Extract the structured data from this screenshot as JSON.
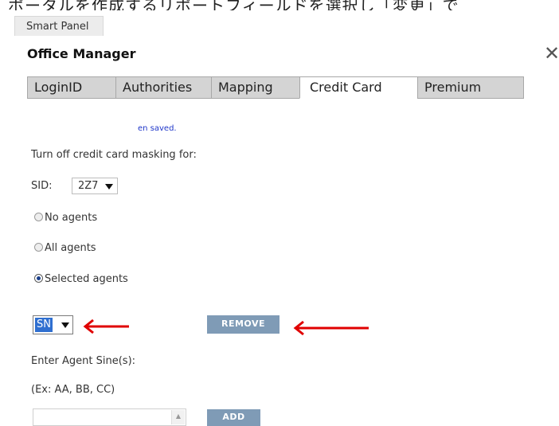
{
  "top_text": "ポータルを作成するリポートフィールドを選択し「変更」で",
  "window": {
    "panel_tab": "Smart Panel",
    "title": "Office Manager",
    "close_symbol": "✕"
  },
  "tabs": [
    {
      "label": "LoginID",
      "active": false
    },
    {
      "label": "Authorities",
      "active": false
    },
    {
      "label": "Mapping",
      "active": false
    },
    {
      "label": "Credit Card",
      "active": true
    },
    {
      "label": "Premium",
      "active": false
    }
  ],
  "status_message": "en saved.",
  "masking_label": "Turn off credit card masking for:",
  "sid": {
    "label": "SID:",
    "value": "2Z7"
  },
  "options": [
    {
      "label": "No agents",
      "checked": false
    },
    {
      "label": "All agents",
      "checked": false
    },
    {
      "label": "Selected agents",
      "checked": true
    }
  ],
  "agent_select": {
    "value": "SN"
  },
  "remove_button": "REMOVE",
  "sine_label": "Enter Agent Sine(s):",
  "sine_example": "(Ex: AA, BB, CC)",
  "add_button": "ADD",
  "colors": {
    "annotation_arrow": "#e00000",
    "button": "#7f9bb6",
    "link": "#1f36c9"
  },
  "icons": {
    "close": "close-icon",
    "dropdown": "chevron-down-icon",
    "annotation": "arrow-left-icon"
  }
}
